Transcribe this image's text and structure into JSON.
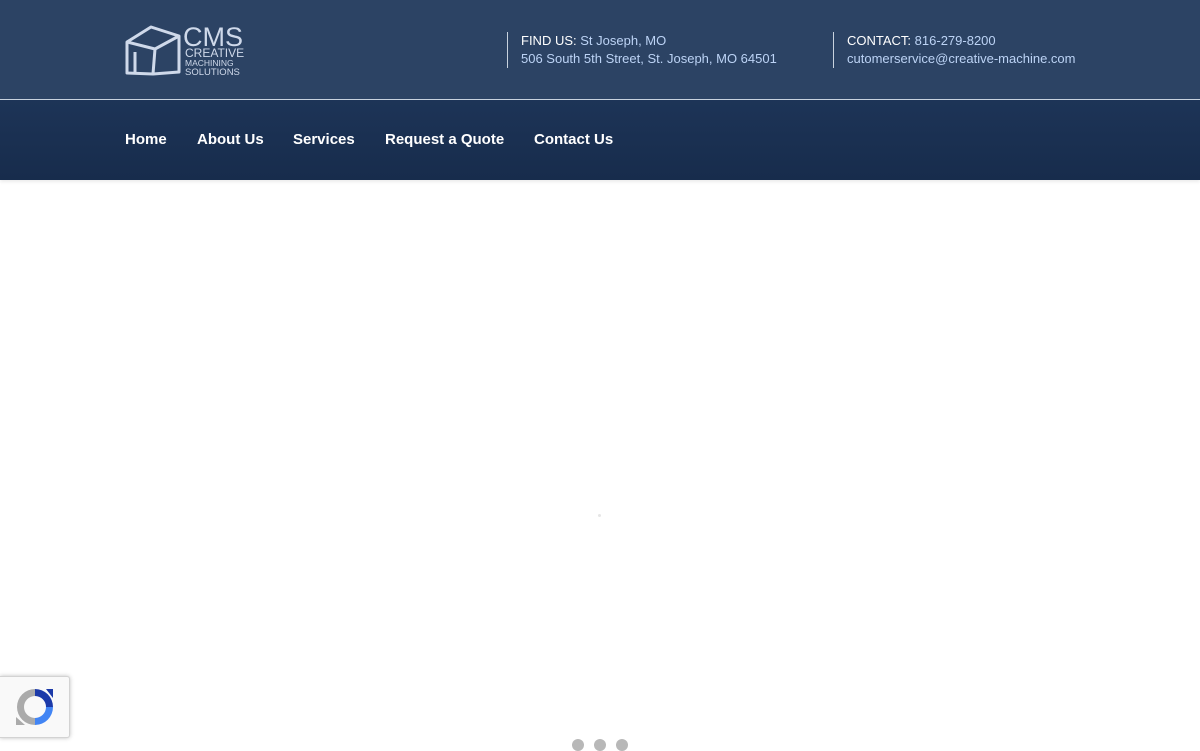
{
  "logo": {
    "title": "CMS",
    "line1": "CREATIVE",
    "line2": "MACHINING",
    "line3": "SOLUTIONS"
  },
  "header": {
    "find_label": "FIND US:",
    "find_city": "St Joseph, MO",
    "find_address": "506 South 5th Street, St. Joseph, MO 64501",
    "contact_label": "CONTACT:",
    "contact_phone": "816-279-8200",
    "contact_email": "cutomerservice@creative-machine.com"
  },
  "nav": {
    "items": [
      {
        "label": "Home"
      },
      {
        "label": "About Us"
      },
      {
        "label": "Services"
      },
      {
        "label": "Request a Quote"
      },
      {
        "label": "Contact Us"
      }
    ]
  },
  "colors": {
    "header_bg": "#2c4364",
    "nav_bg": "#1d3457",
    "accent_link": "#bcd3f5"
  },
  "icons": {
    "logo": "cms-box-logo-icon",
    "recaptcha": "recaptcha-icon",
    "loader": "loading-dots-icon"
  }
}
